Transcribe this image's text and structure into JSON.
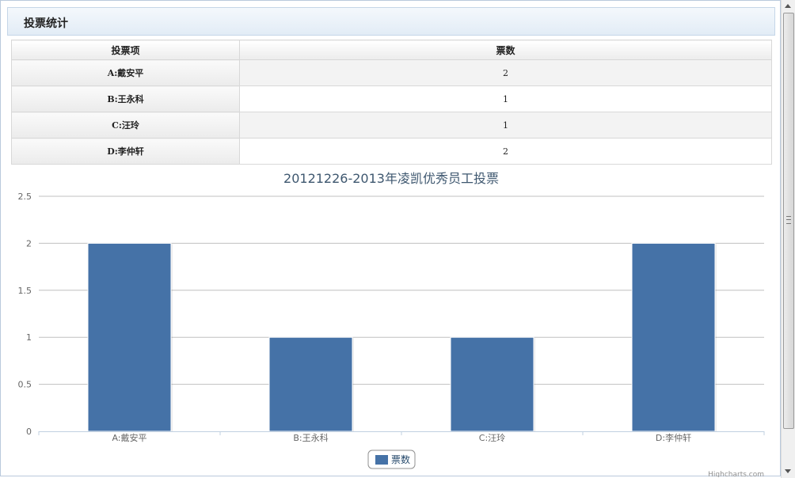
{
  "panel": {
    "title": "投票统计"
  },
  "table": {
    "headers": [
      "投票项",
      "票数"
    ],
    "rows": [
      {
        "label": "A:戴安平",
        "votes": "2"
      },
      {
        "label": "B:王永科",
        "votes": "1"
      },
      {
        "label": "C:汪玲",
        "votes": "1"
      },
      {
        "label": "D:李仲轩",
        "votes": "2"
      }
    ]
  },
  "chart_data": {
    "type": "bar",
    "title": "20121226-2013年凌凯优秀员工投票",
    "categories": [
      "A:戴安平",
      "B:王永科",
      "C:汪玲",
      "D:李仲轩"
    ],
    "series": [
      {
        "name": "票数",
        "values": [
          2,
          1,
          1,
          2
        ],
        "color": "#4572a7"
      }
    ],
    "ylim": [
      0,
      2.5
    ],
    "yticks": [
      "0",
      "0.5",
      "1",
      "1.5",
      "2",
      "2.5"
    ],
    "grid": true,
    "legend": "bottom-center",
    "credits": "Highcharts.com"
  },
  "colors": {
    "bar": "#4572a7",
    "title": "#3e576f",
    "grid": "#c0c0c0",
    "axis": "#c0d0e0"
  }
}
